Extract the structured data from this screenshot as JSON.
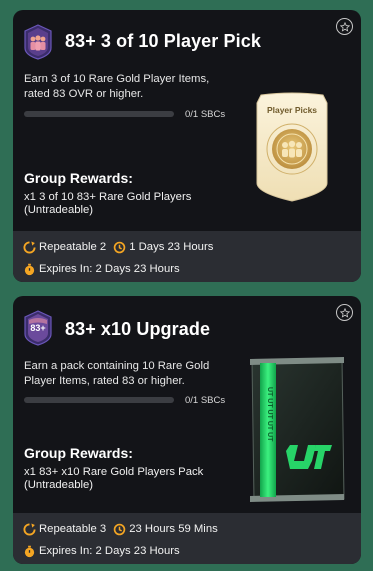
{
  "cards": [
    {
      "title": "83+ 3 of 10 Player Pick",
      "badge_icon": "player-trio-badge-icon",
      "description": "Earn 3 of 10 Rare Gold Player Items, rated 83 OVR or higher.",
      "progress_fraction": 0,
      "sbc_count": "0/1 SBCs",
      "rewards_title": "Group Rewards:",
      "rewards_text": "x1 3 of 10 83+ Rare Gold Players (Untradeable)",
      "reward_item_label": "Player Picks",
      "repeatable": "Repeatable 2",
      "time_left": "1 Days 23 Hours",
      "expires": "Expires In: 2 Days 23 Hours"
    },
    {
      "title": "83+ x10 Upgrade",
      "badge_icon": "83-plus-badge-icon",
      "badge_text": "83+",
      "description": "Earn a pack containing 10 Rare Gold Player Items, rated 83 or higher.",
      "progress_fraction": 0,
      "sbc_count": "0/1 SBCs",
      "rewards_title": "Group Rewards:",
      "rewards_text": "x1 83+ x10 Rare Gold Players Pack (Untradeable)",
      "pack_logo": "UT",
      "repeatable": "Repeatable 3",
      "time_left": "23 Hours 59 Mins",
      "expires": "Expires In: 2 Days 23 Hours"
    }
  ],
  "colors": {
    "page_background": "#2f6e55",
    "card_background": "#131418",
    "footer_background": "#2b2d33",
    "accent_orange": "#f5a623",
    "pack_green": "#22c55e"
  }
}
